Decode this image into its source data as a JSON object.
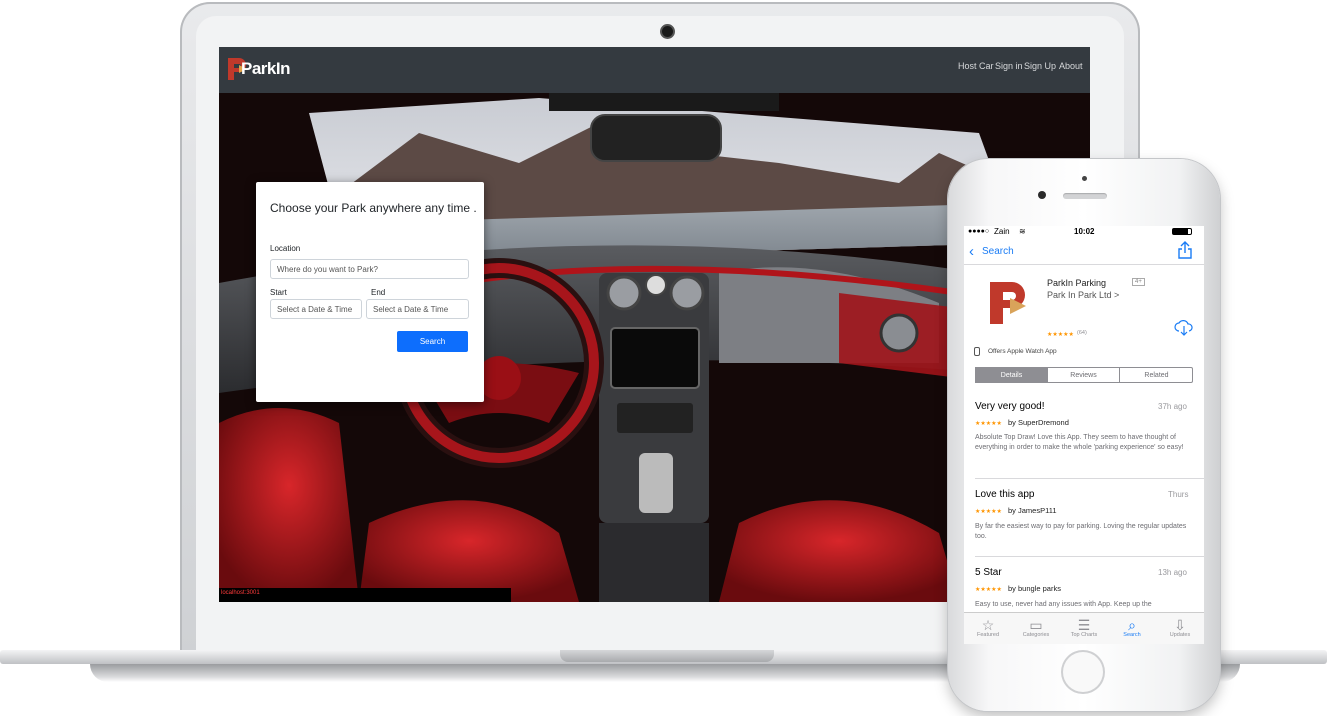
{
  "laptop": {
    "brand_logo_text": "ParkIn",
    "nav": [
      "Host Car",
      "Sign in",
      "Sign Up",
      "About"
    ],
    "search_card": {
      "title": "Choose your Park anywhere any time .",
      "location_label": "Location",
      "location_placeholder": "Where do you want to Park?",
      "start_label": "Start",
      "start_placeholder": "Select a Date & Time",
      "end_label": "End",
      "end_placeholder": "Select a Date & Time",
      "search_button": "Search"
    },
    "status_url": "localhost:3001"
  },
  "phone": {
    "status": {
      "carrier": "Zain",
      "time": "10:02"
    },
    "back_label": "Search",
    "app": {
      "name": "ParkIn Parking",
      "age_rating": "4+",
      "developer": "Park In Park Ltd >",
      "rating_count": "(64)",
      "watch_note": "Offers Apple Watch App"
    },
    "segments": [
      "Details",
      "Reviews",
      "Related"
    ],
    "reviews": [
      {
        "title": "Very very good!",
        "time": "37h ago",
        "author": "by SuperDremond",
        "body": "Absolute Top Draw! Love this App. They seem to have thought of everything in order to make the whole 'parking experience' so easy!"
      },
      {
        "title": "Love this app",
        "time": "Thurs",
        "author": "by JamesP111",
        "body": "By far the easiest way to pay for parking. Loving the regular updates too."
      },
      {
        "title": "5 Star",
        "time": "13h ago",
        "author": "by bungle parks",
        "body": "Easy to use, never had any issues with App. Keep up the"
      }
    ],
    "tabbar": [
      "Featured",
      "Categories",
      "Top Charts",
      "Search",
      "Updates"
    ],
    "stars": "★★★★★"
  },
  "colors": {
    "navbar": "#343a40",
    "primary": "#0d6efd",
    "brand": "#c0392b",
    "ios_blue": "#1a7cf5"
  }
}
